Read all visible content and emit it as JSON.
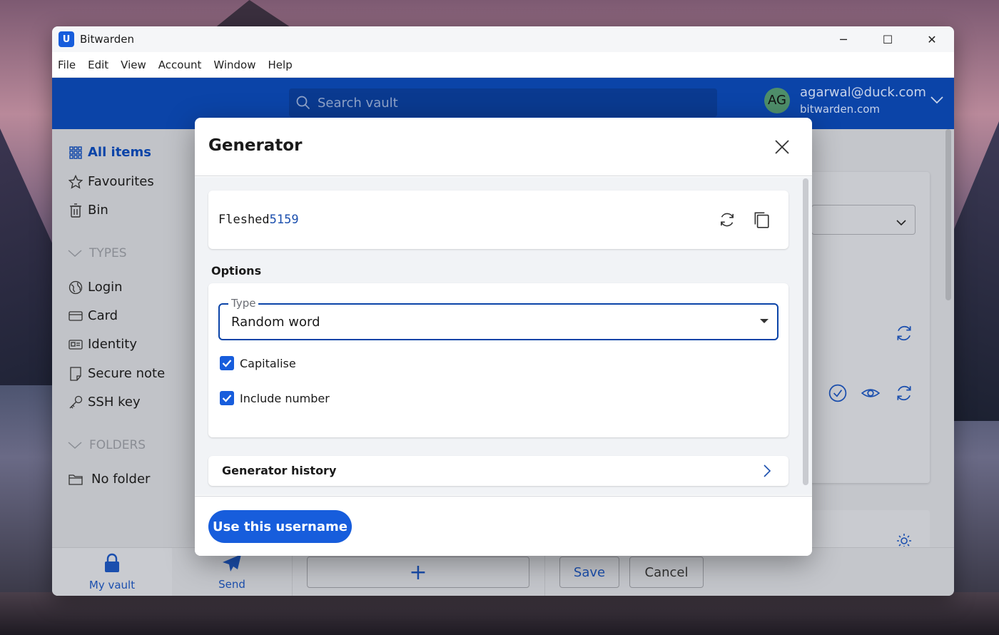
{
  "window": {
    "title": "Bitwarden",
    "logo_letter": "U",
    "minimize_glyph": "─",
    "maximize_glyph": "☐",
    "close_glyph": "✕"
  },
  "menu": [
    "File",
    "Edit",
    "View",
    "Account",
    "Window",
    "Help"
  ],
  "search": {
    "placeholder": "Search vault"
  },
  "account": {
    "initials": "AG",
    "email": "agarwal@duck.com",
    "server": "bitwarden.com"
  },
  "sidebar": {
    "all_items": "All items",
    "favourites": "Favourites",
    "bin": "Bin",
    "types_header": "TYPES",
    "types": [
      "Login",
      "Card",
      "Identity",
      "Secure note",
      "SSH key"
    ],
    "folders_header": "FOLDERS",
    "no_folder": "No folder"
  },
  "bottom": {
    "my_vault": "My vault",
    "send": "Send",
    "add_glyph": "+",
    "save": "Save",
    "cancel": "Cancel"
  },
  "modal": {
    "title": "Generator",
    "generated_word": "Fleshed",
    "generated_number": "5159",
    "options_label": "Options",
    "type_legend": "Type",
    "type_value": "Random word",
    "capitalise_label": "Capitalise",
    "include_number_label": "Include number",
    "capitalise_checked": true,
    "include_number_checked": true,
    "history_label": "Generator history",
    "use_button": "Use this username"
  },
  "colors": {
    "accent": "#175ddc",
    "topbar": "#0b44a8",
    "avatar": "#4e8e6a"
  }
}
